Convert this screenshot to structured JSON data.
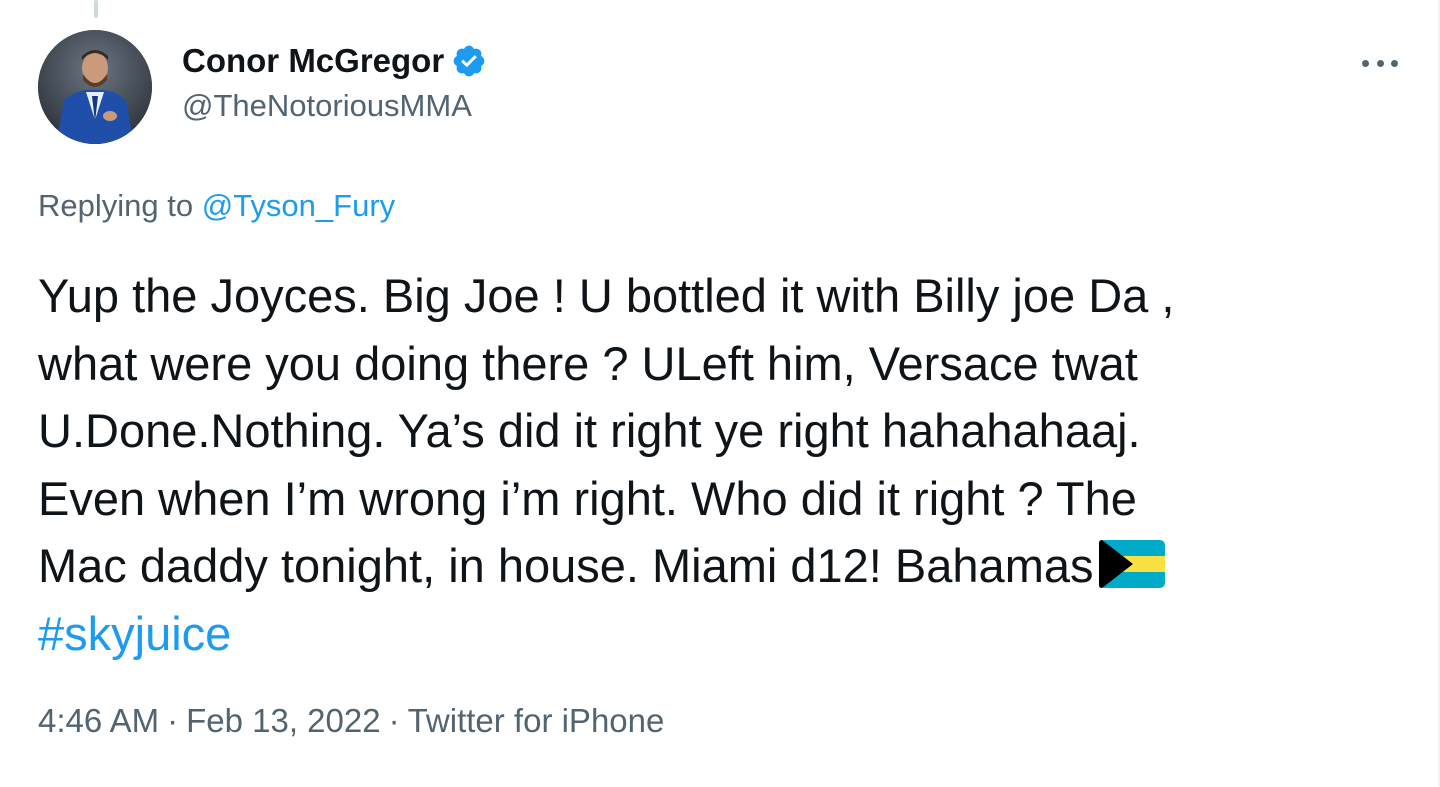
{
  "tweet": {
    "author": {
      "display_name": "Conor McGregor",
      "handle": "@TheNotoriousMMA",
      "verified_icon": "verified-badge-icon",
      "avatar_icon": "avatar"
    },
    "more_icon": "more-dots-icon",
    "replying_to": {
      "prefix": "Replying to",
      "mention": "@Tyson_Fury"
    },
    "body_lines": [
      "Yup the Joyces. Big Joe ! U bottled it with Billy joe Da ,",
      "what were you doing there ? ULeft him, Versace twat",
      "U.Done.Nothing. Ya’s did it right ye right hahahahaaj.",
      "Even when I’m wrong i’m right. Who did it right ? The",
      "Mac daddy tonight, in house. Miami d12! Bahamas"
    ],
    "flag_icon": "bahamas-flag-icon",
    "hashtag": "#skyjuice",
    "meta": {
      "time": "4:46 AM",
      "separator": "·",
      "date": "Feb 13, 2022",
      "source": "Twitter for iPhone"
    }
  },
  "colors": {
    "text": "#0f1419",
    "secondary": "#536471",
    "link": "#1d9bf0",
    "verified": "#1d9bf0"
  }
}
